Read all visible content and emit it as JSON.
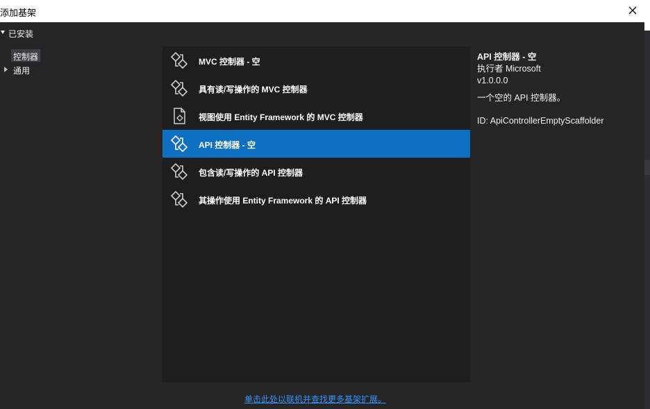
{
  "window": {
    "title": "添加基架"
  },
  "tree": {
    "installed_label": "已安装",
    "controllers_label": "控制器",
    "general_label": "通用"
  },
  "items": [
    {
      "label": "MVC 控制器 - 空",
      "icon": "controller-icon"
    },
    {
      "label": "具有读/写操作的 MVC 控制器",
      "icon": "controller-icon"
    },
    {
      "label": "视图使用 Entity Framework 的 MVC 控制器",
      "icon": "view-controller-icon"
    },
    {
      "label": "API 控制器 - 空",
      "icon": "controller-icon"
    },
    {
      "label": "包含读/写操作的 API 控制器",
      "icon": "controller-icon"
    },
    {
      "label": "其操作使用 Entity Framework 的 API 控制器",
      "icon": "controller-icon"
    }
  ],
  "selected_index": 3,
  "details": {
    "name": "API 控制器 - 空",
    "author": "执行者 Microsoft",
    "version": "v1.0.0.0",
    "description": "一个空的 API 控制器。",
    "id": "ID: ApiControllerEmptyScaffolder"
  },
  "footer": {
    "link_text": "单击此处以联机并查找更多基架扩展。"
  },
  "colors": {
    "selected": "#0e70c0",
    "link": "#3794ff",
    "background": "#252526",
    "list_background": "#1e1e1e"
  }
}
